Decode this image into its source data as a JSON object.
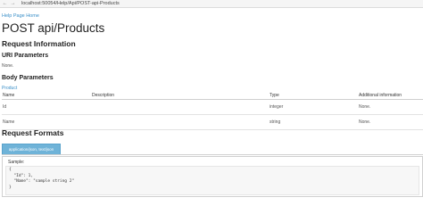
{
  "browser": {
    "back_symbol": "←",
    "forward_symbol": "→",
    "url": "localhost:50054/Help/Api/POST-api-Products"
  },
  "page": {
    "home_link": "Help Page Home",
    "title": "POST api/Products"
  },
  "request_information": {
    "heading": "Request Information",
    "uri_parameters": {
      "heading": "URI Parameters",
      "value": "None."
    },
    "body_parameters": {
      "heading": "Body Parameters",
      "type_link": "Product",
      "columns": [
        "Name",
        "Description",
        "Type",
        "Additional information"
      ],
      "rows": [
        {
          "name": "Id",
          "description": "",
          "type": "integer",
          "info": "None."
        },
        {
          "name": "Name",
          "description": "",
          "type": "string",
          "info": "None."
        }
      ]
    }
  },
  "request_formats": {
    "heading": "Request Formats",
    "active_tab": "application/json, text/json",
    "sample_label": "Sample:",
    "code_lines": [
      "{",
      "  \"Id\": 1,",
      "  \"Name\": \"sample string 2\"",
      "}"
    ]
  },
  "colors": {
    "link": "#3a8fc8",
    "tab_background": "#6fb3d8",
    "text": "#222222"
  }
}
